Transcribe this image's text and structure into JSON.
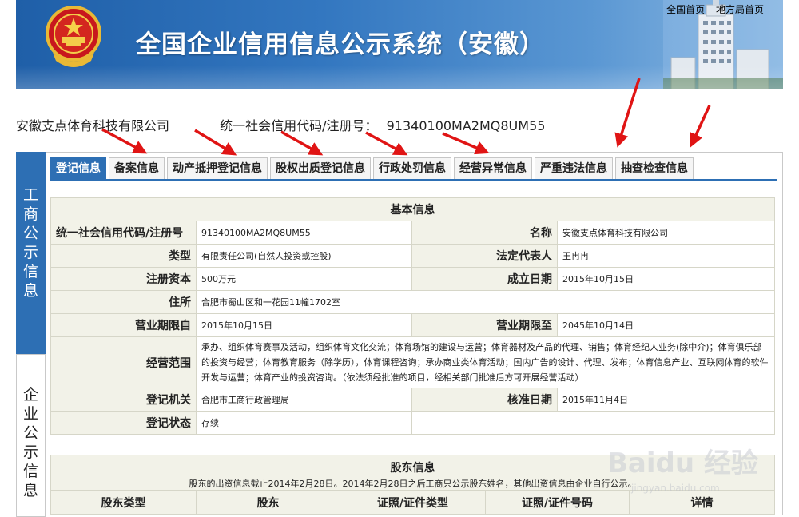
{
  "header": {
    "title": "全国企业信用信息公示系统（安徽）",
    "links": [
      "全国首页",
      "地方局首页"
    ]
  },
  "company": {
    "name": "安徽支点体育科技有限公司",
    "code_label": "统一社会信用代码/注册号：",
    "code_value": "91340100MA2MQ8UM55"
  },
  "side_nav": {
    "gongshang": [
      "工",
      "商",
      "公",
      "示",
      "信",
      "息"
    ],
    "qiye": [
      "企",
      "业",
      "公",
      "示",
      "信",
      "息"
    ]
  },
  "tabs": [
    "登记信息",
    "备案信息",
    "动产抵押登记信息",
    "股权出质登记信息",
    "行政处罚信息",
    "经营异常信息",
    "严重违法信息",
    "抽查检查信息"
  ],
  "basic": {
    "caption": "基本信息",
    "code_label": "统一社会信用代码/注册号",
    "code_value": "91340100MA2MQ8UM55",
    "name_label": "名称",
    "name_value": "安徽支点体育科技有限公司",
    "type_label": "类型",
    "type_value": "有限责任公司(自然人投资或控股)",
    "rep_label": "法定代表人",
    "rep_value": "王冉冉",
    "capital_label": "注册资本",
    "capital_value": "500万元",
    "found_label": "成立日期",
    "found_value": "2015年10月15日",
    "address_label": "住所",
    "address_value": "合肥市蜀山区和一花园11幢1702室",
    "from_label": "营业期限自",
    "from_value": "2015年10月15日",
    "to_label": "营业期限至",
    "to_value": "2045年10月14日",
    "scope_label": "经营范围",
    "scope_value": "承办、组织体育赛事及活动，组织体育文化交流；体育场馆的建设与运营；体育器材及产品的代理、销售；体育经纪人业务(除中介)；体育俱乐部的投资与经营；体育教育服务（除学历），体育课程咨询；承办商业类体育活动；国内广告的设计、代理、发布；体育信息产业、互联网体育的软件开发与运营；体育产业的投资咨询。（依法须经批准的项目，经相关部门批准后方可开展经营活动）",
    "authority_label": "登记机关",
    "authority_value": "合肥市工商行政管理局",
    "approve_label": "核准日期",
    "approve_value": "2015年11月4日",
    "status_label": "登记状态",
    "status_value": "存续"
  },
  "shareholder": {
    "caption": "股东信息",
    "note": "股东的出资信息截止2014年2月28日。2014年2月28日之后工商只公示股东姓名，其他出资信息由企业自行公示。",
    "columns": [
      "股东类型",
      "股东",
      "证照/证件类型",
      "证照/证件号码",
      "详情"
    ]
  },
  "watermark": {
    "logo": "Baidu 经验",
    "url": "jingyan.baidu.com"
  },
  "colors": {
    "banner_blue": "#2d6fb4",
    "label_bg": "#f2f2e8",
    "arrow_red": "#e01414"
  }
}
